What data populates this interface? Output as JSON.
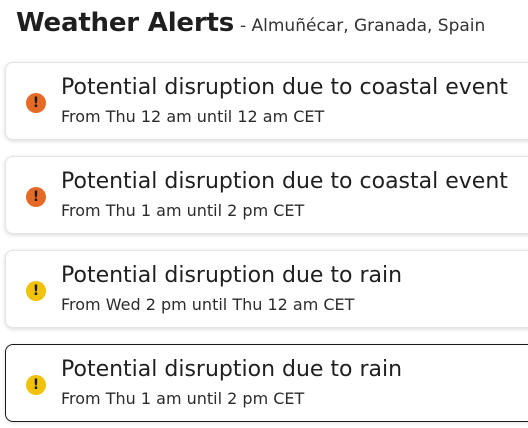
{
  "header": {
    "title": "Weather Alerts",
    "location": "- Almuñécar, Granada, Spain"
  },
  "colors": {
    "severity_orange": "#e46a25",
    "severity_yellow": "#f2c20a"
  },
  "alerts": [
    {
      "title": "Potential disruption due to coastal event",
      "time": "From Thu 12 am until 12 am CET",
      "severity": "orange",
      "icon": "exclamation-icon"
    },
    {
      "title": "Potential disruption due to coastal event",
      "time": "From Thu 1 am until 2 pm CET",
      "severity": "orange",
      "icon": "exclamation-icon"
    },
    {
      "title": "Potential disruption due to rain",
      "time": "From Wed 2 pm until Thu 12 am CET",
      "severity": "yellow",
      "icon": "exclamation-icon"
    },
    {
      "title": "Potential disruption due to rain",
      "time": "From Thu 1 am until 2 pm CET",
      "severity": "yellow",
      "icon": "exclamation-icon",
      "selected": true
    }
  ]
}
